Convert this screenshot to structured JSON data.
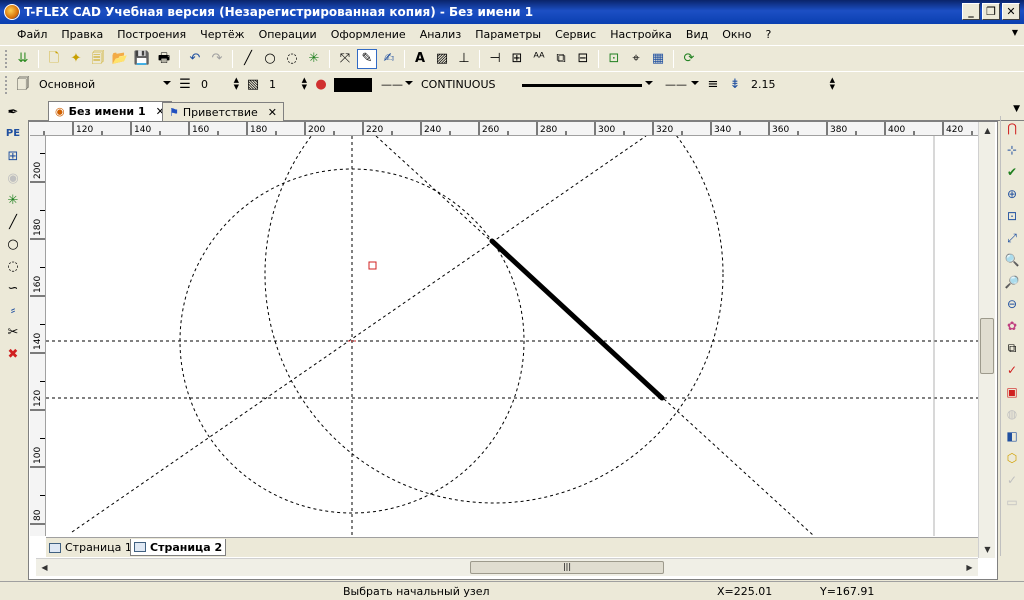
{
  "window": {
    "title": "T-FLEX CAD Учебная версия (Незарегистрированная копия) - Без имени 1"
  },
  "menu": [
    "Файл",
    "Правка",
    "Построения",
    "Чертёж",
    "Операции",
    "Оформление",
    "Анализ",
    "Параметры",
    "Сервис",
    "Настройка",
    "Вид",
    "Окно",
    "?"
  ],
  "properties": {
    "style": "Основной",
    "layer": "0",
    "level": "1",
    "color": "#000000",
    "linetype": "CONTINUOUS",
    "thickness": "2.15"
  },
  "tabs": [
    {
      "label": "Без имени 1",
      "active": true
    },
    {
      "label": "Приветствие",
      "active": false
    }
  ],
  "rulers": {
    "x_ticks": [
      "120",
      "140",
      "160",
      "180",
      "200",
      "220",
      "240",
      "260",
      "280",
      "300",
      "320",
      "340",
      "360",
      "380",
      "400",
      "420"
    ],
    "y_ticks": [
      "80",
      "100",
      "120",
      "140",
      "160",
      "180",
      "200"
    ]
  },
  "pages": [
    {
      "label": "Страница 1",
      "active": false
    },
    {
      "label": "Страница 2",
      "active": true
    }
  ],
  "status": {
    "prompt": "Выбрать начальный узел",
    "x": "X=225.01",
    "y": "Y=167.91"
  }
}
